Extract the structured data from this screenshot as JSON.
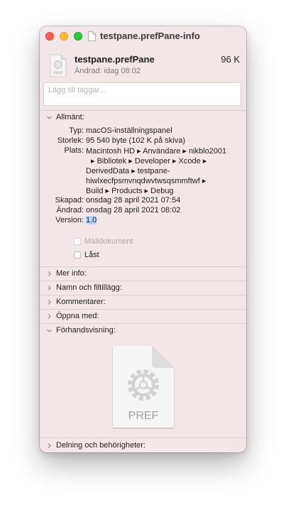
{
  "window": {
    "title": "testpane.prefPane-info"
  },
  "file": {
    "name": "testpane.prefPane",
    "size": "96 K",
    "modified": "Ändrad: idag 08:02",
    "icon_label": "PREF"
  },
  "tags": {
    "placeholder": "Lägg till taggar..."
  },
  "general": {
    "label": "Allmänt:",
    "rows": {
      "type": {
        "key": "Typ:",
        "value": "macOS-inställningspanel"
      },
      "size": {
        "key": "Storlek:",
        "value": "95 540 byte (102 K på skiva)"
      },
      "where": {
        "key": "Plats:",
        "lines": [
          "Macintosh HD ▸ Användare ▸ nikblo2001",
          "▸ Bibliotek ▸ Developer ▸ Xcode ▸",
          "DerivedData ▸ testpane-",
          "hiwlxecfpsmvnqdwvtwsqsmmftwf ▸",
          "Build ▸ Products ▸ Debug"
        ]
      },
      "created": {
        "key": "Skapad:",
        "value": "onsdag 28 april 2021 07:54"
      },
      "modified": {
        "key": "Ändrad:",
        "value": "onsdag 28 april 2021 08:02"
      },
      "version": {
        "key": "Version:",
        "value": "1.0"
      }
    },
    "stationery": {
      "label": "Malldokument",
      "checked": false,
      "enabled": false
    },
    "locked": {
      "label": "Låst",
      "checked": false,
      "enabled": true
    }
  },
  "sections": {
    "more_info": "Mer info:",
    "name_ext": "Namn och filtillägg:",
    "comments": "Kommentarer:",
    "open_with": "Öppna med:",
    "preview": "Förhandsvisning:",
    "sharing": "Delning och behörigheter:"
  },
  "preview": {
    "icon_label": "PREF"
  },
  "colors": {
    "window_bg": "#f3e6e8",
    "close": "#fe5f57",
    "minimize": "#febc2e",
    "zoom": "#28c840",
    "selection": "#b4d5fe"
  }
}
